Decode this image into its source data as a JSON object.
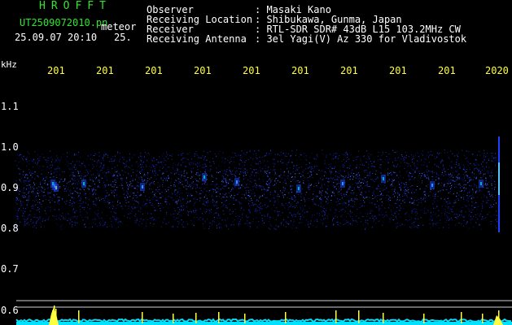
{
  "header": {
    "app_title": "HROFFT",
    "file_name": "UT2509072010.pn",
    "file_suffix": "meteor",
    "datetime": "25.09.07 20:10",
    "extra_value": "25.",
    "fields": [
      {
        "label": "Observer",
        "value": ": Masaki Kano"
      },
      {
        "label": "Receiving Location",
        "value": ": Shibukawa, Gunma, Japan"
      },
      {
        "label": "Receiver",
        "value": ": RTL-SDR SDR# 43dB L15 103.2MHz CW"
      },
      {
        "label": "Receiving Antenna",
        "value": ": 3el Yagi(V) Az 330 for Vladivostok"
      }
    ]
  },
  "y_axis": {
    "unit": "kHz",
    "ticks": [
      "1.1",
      "1.0",
      "0.9",
      "0.8",
      "0.7",
      "0.6"
    ]
  },
  "x_axis": {
    "ticks": [
      "201",
      "201",
      "201",
      "201",
      "201",
      "201",
      "201",
      "201",
      "201",
      "2020"
    ]
  },
  "colors": {
    "background": "#000000",
    "text": "#ffffff",
    "title": "#2ee62e",
    "axis_ticks": "#ffff40",
    "noise": "#1a2cff",
    "baseline": "#00e0ff",
    "spikes": "#ffff40"
  }
}
